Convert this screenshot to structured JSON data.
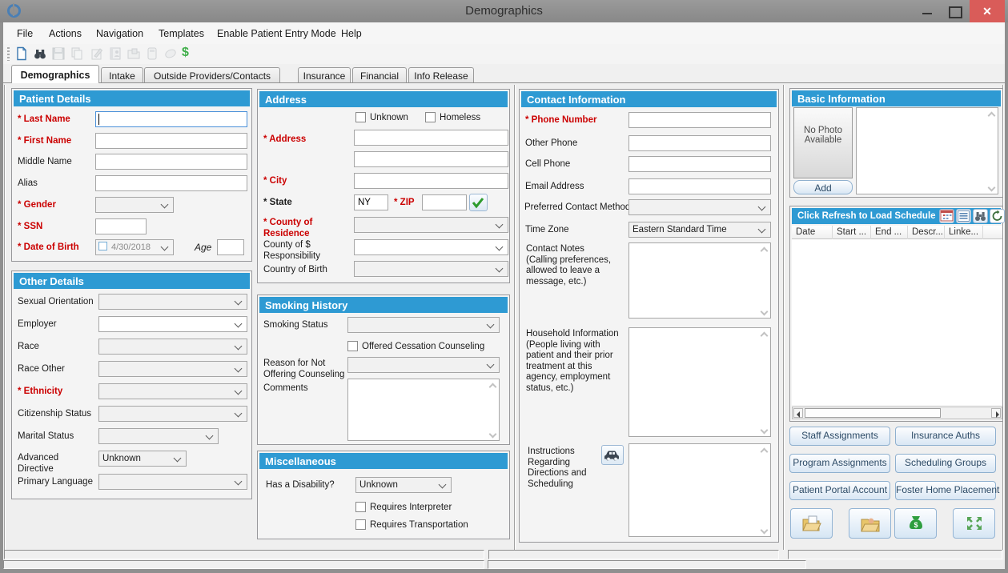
{
  "window": {
    "title": "Demographics"
  },
  "menu": {
    "items": [
      "File",
      "Actions",
      "Navigation",
      "Templates",
      "Enable Patient Entry Mode",
      "Help"
    ]
  },
  "toolbar": {
    "icons": [
      "new-patient",
      "find",
      "save",
      "copy",
      "edit",
      "address-book",
      "folder-secure",
      "notes",
      "eraser",
      "billing"
    ],
    "billing_symbol": "$"
  },
  "tabs": {
    "items": [
      "Demographics",
      "Intake",
      "Outside Providers/Contacts",
      "Insurance",
      "Financial",
      "Info Release"
    ],
    "active": "Demographics"
  },
  "patient": {
    "title": "Patient Details",
    "last_name": "* Last Name",
    "first_name": "* First Name",
    "middle_name": "Middle Name",
    "alias": "Alias",
    "gender": "* Gender",
    "ssn": "* SSN",
    "dob": "* Date of Birth",
    "dob_value": "4/30/2018",
    "age": "Age"
  },
  "other": {
    "title": "Other Details",
    "sexual_orientation": "Sexual Orientation",
    "employer": "Employer",
    "race": "Race",
    "race_other": "Race Other",
    "ethnicity": "* Ethnicity",
    "citizenship": "Citizenship Status",
    "marital": "Marital Status",
    "advanced_directive": "Advanced Directive",
    "advanced_directive_value": "Unknown",
    "primary_language": "Primary Language"
  },
  "address": {
    "title": "Address",
    "unknown": "Unknown",
    "homeless": "Homeless",
    "address": "* Address",
    "city": "* City",
    "state": "* State",
    "state_value": "NY",
    "zip": "* ZIP",
    "county_residence": "* County of Residence",
    "county_responsibility": "County of $ Responsibility",
    "country_birth": "Country of Birth"
  },
  "smoking": {
    "title": "Smoking History",
    "status": "Smoking Status",
    "offered": "Offered Cessation Counseling",
    "reason": "Reason for Not Offering Counseling",
    "comments": "Comments"
  },
  "misc": {
    "title": "Miscellaneous",
    "disability": "Has a Disability?",
    "disability_value": "Unknown",
    "interpreter": "Requires Interpreter",
    "transportation": "Requires Transportation"
  },
  "contact": {
    "title": "Contact Information",
    "phone": "* Phone Number",
    "other_phone": "Other Phone",
    "cell_phone": "Cell Phone",
    "email": "Email Address",
    "preferred": "Preferred Contact Method",
    "timezone": "Time Zone",
    "timezone_value": "Eastern Standard Time",
    "notes": "Contact Notes (Calling preferences, allowed to leave a message, etc.)",
    "household": "Household Information (People living with patient and their prior treatment at this agency, employment status, etc.)",
    "instructions": "Instructions Regarding Directions and Scheduling"
  },
  "basic": {
    "title": "Basic Information",
    "no_photo": "No Photo Available",
    "add": "Add"
  },
  "schedule": {
    "title": "Click Refresh to Load Schedule",
    "columns": [
      "Date",
      "Start ...",
      "End ...",
      "Descr...",
      "Linke..."
    ],
    "icons": [
      "calendar",
      "list",
      "find",
      "refresh"
    ]
  },
  "actions": {
    "staff": "Staff Assignments",
    "insurance_auths": "Insurance Auths",
    "program": "Program Assignments",
    "scheduling_groups": "Scheduling Groups",
    "portal": "Patient Portal Account",
    "foster": "Foster Home Placement",
    "icon_buttons": [
      "open-chart",
      "patient-folder",
      "billing-money",
      "sync-arrows"
    ]
  }
}
